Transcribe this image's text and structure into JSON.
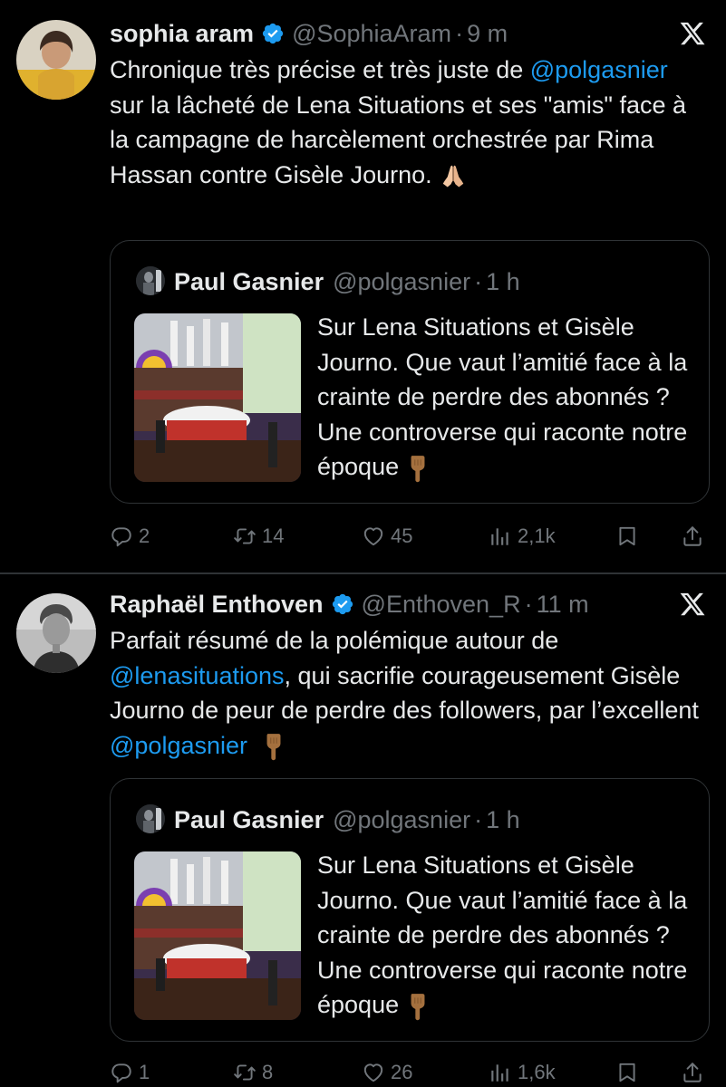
{
  "tweets": [
    {
      "author": {
        "name": "sophia aram",
        "handle": "@SophiaAram",
        "time": "9 m",
        "verified": true
      },
      "text": {
        "part1": "Chronique très précise et très juste de ",
        "mention1": "@polgasnier",
        "part2": " sur la lâcheté de Lena Situations et ses \"amis\" face à la campagne de harcèlement orchestrée par Rima Hassan contre Gisèle Journo.",
        "emoji": "folded-hands"
      },
      "quote": {
        "name": "Paul Gasnier",
        "handle": "@polgasnier",
        "time": "1 h",
        "text": "Sur Lena Situations et Gisèle Journo. Que vaut l’amitié face à la crainte de perdre des abonnés ? Une controverse qui raconte notre époque",
        "emoji": "pointing-down"
      },
      "actions": {
        "replies": "2",
        "retweets": "14",
        "likes": "45",
        "views": "2,1k"
      }
    },
    {
      "author": {
        "name": "Raphaël Enthoven",
        "handle": "@Enthoven_R",
        "time": "11 m",
        "verified": true
      },
      "text": {
        "part1": "Parfait résumé de la polémique autour de ",
        "mention1": "@lenasituations",
        "part2": ", qui sacrifie courageusement Gisèle Journo de peur de perdre des followers, par l’excellent ",
        "mention2": "@polgasnier",
        "emoji": "pointing-down"
      },
      "quote": {
        "name": "Paul Gasnier",
        "handle": "@polgasnier",
        "time": "1 h",
        "text": "Sur Lena Situations et Gisèle Journo. Que vaut l’amitié face à la crainte de perdre des abonnés ? Une controverse qui raconte notre époque",
        "emoji": "pointing-down"
      },
      "actions": {
        "replies": "1",
        "retweets": "8",
        "likes": "26",
        "views": "1,6k"
      }
    }
  ],
  "separator": "·",
  "icons": {
    "verified": "verified-badge-icon",
    "platform": "x-logo-icon",
    "reply": "reply-icon",
    "retweet": "retweet-icon",
    "like": "heart-icon",
    "views": "views-icon",
    "bookmark": "bookmark-icon",
    "share": "share-icon"
  },
  "colors": {
    "background": "#000000",
    "text": "#e7e9ea",
    "muted": "#71767b",
    "link": "#1d9bf0",
    "border": "#2f3336",
    "verified": "#1d9bf0"
  }
}
